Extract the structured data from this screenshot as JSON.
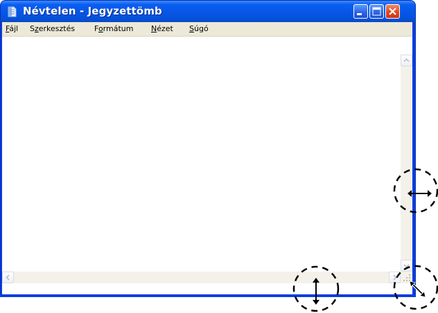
{
  "window": {
    "title": "Névtelen - Jegyzettömb",
    "icon": "notepad-icon",
    "colors": {
      "title_bar": "#0657e8",
      "close_button": "#df4a20",
      "menu_bg": "#ece9d8",
      "editor_bg": "#ffffff"
    }
  },
  "titlebar_buttons": {
    "minimize": "minimize-icon",
    "maximize": "maximize-icon",
    "close": "close-icon"
  },
  "menu": {
    "items": [
      {
        "hotkey": "F",
        "rest": "ájl"
      },
      {
        "pre": "S",
        "hotkey": "z",
        "rest": "erkesztés"
      },
      {
        "pre": "F",
        "hotkey": "o",
        "rest": "rmátum"
      },
      {
        "hotkey": "N",
        "rest": "ézet"
      },
      {
        "hotkey": "S",
        "rest": "úgó"
      }
    ]
  },
  "editor": {
    "content": ""
  },
  "resize_cursors": {
    "right_edge": "resize-horizontal-cursor",
    "bottom_edge": "resize-vertical-cursor",
    "corner": "resize-diagonal-cursor"
  }
}
